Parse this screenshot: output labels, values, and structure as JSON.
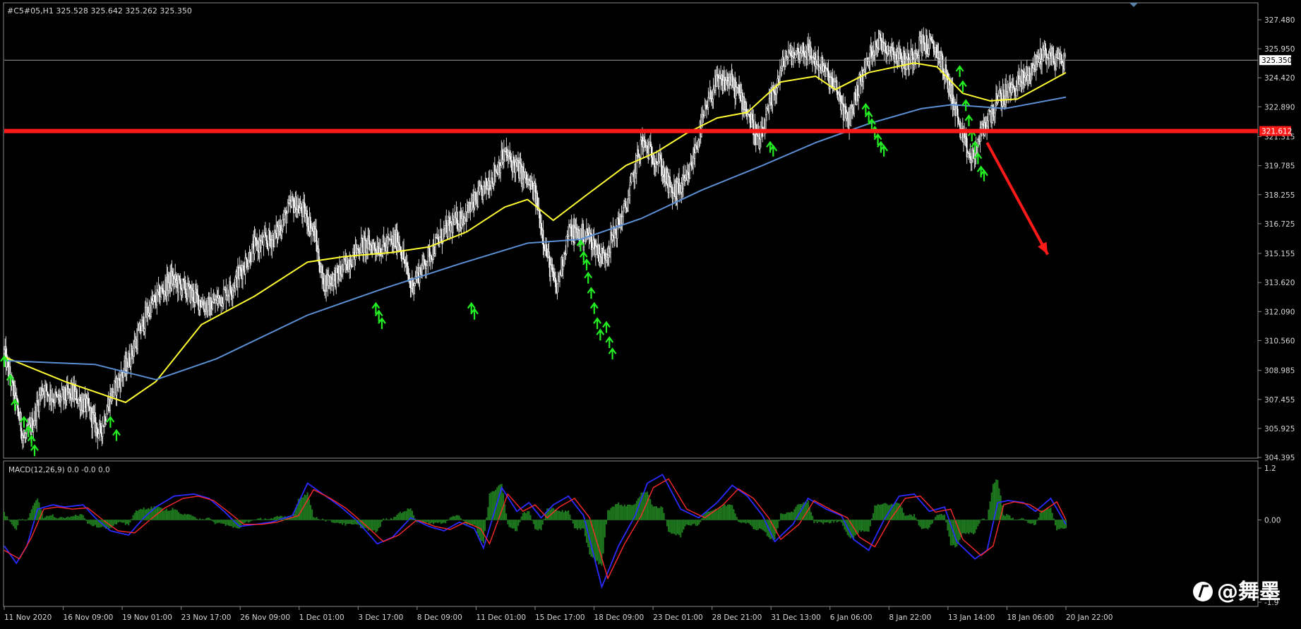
{
  "chart_data": [
    {
      "type": "candlestick",
      "symbol_info": "#C5#05,H1  325.528 325.642 325.262 325.350",
      "ylim": [
        304.395,
        327.48
      ],
      "y_ticks": [
        327.48,
        325.95,
        324.42,
        322.89,
        321.315,
        319.785,
        318.255,
        316.725,
        315.155,
        313.62,
        312.09,
        310.56,
        308.985,
        307.455,
        305.925,
        304.395
      ],
      "y_tick_labels": [
        "327.480",
        "325.950",
        "324.420",
        "322.890",
        "321.315",
        "319.785",
        "318.255",
        "316.725",
        "315.155",
        "313.620",
        "312.090",
        "310.560",
        "308.985",
        "307.455",
        "305.925",
        "304.395"
      ],
      "x_tick_labels": [
        "11 Nov 2020",
        "16 Nov 09:00",
        "19 Nov 01:00",
        "23 Nov 17:00",
        "26 Nov 09:00",
        "1 Dec 01:00",
        "3 Dec 17:00",
        "8 Dec 09:00",
        "11 Dec 01:00",
        "15 Dec 17:00",
        "18 Dec 09:00",
        "23 Dec 01:00",
        "28 Dec 21:00",
        "31 Dec 13:00",
        "6 Jan 06:00",
        "8 Jan 22:00",
        "13 Jan 14:00",
        "18 Jan 06:00",
        "20 Jan 22:00"
      ],
      "current_price": 325.35,
      "current_price_label": "325.350",
      "support_level": 321.612,
      "support_label": "321.612",
      "price_path": [
        [
          0,
          309.9
        ],
        [
          8,
          307.2
        ],
        [
          13,
          305.3
        ],
        [
          18,
          306.0
        ],
        [
          25,
          308.1
        ],
        [
          35,
          307.4
        ],
        [
          45,
          307.8
        ],
        [
          55,
          307.0
        ],
        [
          63,
          305.6
        ],
        [
          70,
          307.6
        ],
        [
          80,
          309.1
        ],
        [
          95,
          312.2
        ],
        [
          110,
          313.8
        ],
        [
          120,
          313.2
        ],
        [
          135,
          312.3
        ],
        [
          150,
          313.4
        ],
        [
          165,
          315.5
        ],
        [
          178,
          316.0
        ],
        [
          190,
          317.8
        ],
        [
          198,
          317.3
        ],
        [
          205,
          316.1
        ],
        [
          210,
          313.6
        ],
        [
          220,
          314.0
        ],
        [
          235,
          315.6
        ],
        [
          250,
          315.5
        ],
        [
          260,
          315.9
        ],
        [
          268,
          313.4
        ],
        [
          278,
          314.8
        ],
        [
          290,
          316.3
        ],
        [
          305,
          317.3
        ],
        [
          318,
          318.7
        ],
        [
          330,
          320.4
        ],
        [
          340,
          319.5
        ],
        [
          350,
          318.3
        ],
        [
          358,
          315.0
        ],
        [
          364,
          313.2
        ],
        [
          372,
          316.3
        ],
        [
          385,
          316.1
        ],
        [
          395,
          314.9
        ],
        [
          410,
          317.6
        ],
        [
          420,
          321.0
        ],
        [
          432,
          320.0
        ],
        [
          440,
          318.3
        ],
        [
          450,
          318.9
        ],
        [
          460,
          322.0
        ],
        [
          468,
          324.0
        ],
        [
          478,
          324.3
        ],
        [
          488,
          323.1
        ],
        [
          498,
          320.9
        ],
        [
          505,
          323.0
        ],
        [
          515,
          325.5
        ],
        [
          528,
          325.9
        ],
        [
          538,
          325.1
        ],
        [
          550,
          323.6
        ],
        [
          556,
          322.0
        ],
        [
          565,
          324.4
        ],
        [
          575,
          326.4
        ],
        [
          585,
          325.9
        ],
        [
          595,
          325.2
        ],
        [
          605,
          326.3
        ],
        [
          615,
          325.9
        ],
        [
          625,
          323.5
        ],
        [
          632,
          321.1
        ],
        [
          638,
          320.0
        ],
        [
          645,
          321.7
        ],
        [
          655,
          323.2
        ],
        [
          665,
          323.9
        ],
        [
          675,
          324.6
        ],
        [
          685,
          325.8
        ],
        [
          692,
          325.4
        ],
        [
          700,
          325.35
        ]
      ],
      "series": [
        {
          "name": "",
          "color": "#ffff33",
          "values": [
            [
              0,
              309.7
            ],
            [
              40,
              308.4
            ],
            [
              80,
              307.3
            ],
            [
              100,
              308.4
            ],
            [
              130,
              311.4
            ],
            [
              165,
              312.9
            ],
            [
              200,
              314.7
            ],
            [
              225,
              315.0
            ],
            [
              255,
              315.2
            ],
            [
              280,
              315.5
            ],
            [
              305,
              316.3
            ],
            [
              330,
              317.6
            ],
            [
              345,
              318.0
            ],
            [
              362,
              316.9
            ],
            [
              385,
              318.3
            ],
            [
              410,
              319.8
            ],
            [
              430,
              320.5
            ],
            [
              450,
              321.5
            ],
            [
              470,
              322.3
            ],
            [
              490,
              322.6
            ],
            [
              512,
              324.2
            ],
            [
              535,
              324.5
            ],
            [
              548,
              323.8
            ],
            [
              570,
              324.7
            ],
            [
              600,
              325.2
            ],
            [
              615,
              325.0
            ],
            [
              632,
              323.6
            ],
            [
              650,
              323.2
            ],
            [
              668,
              323.3
            ],
            [
              700,
              324.7
            ]
          ]
        },
        {
          "name": "",
          "color": "#5b8fd4",
          "values": [
            [
              0,
              309.5
            ],
            [
              60,
              309.3
            ],
            [
              100,
              308.5
            ],
            [
              140,
              309.6
            ],
            [
              200,
              311.9
            ],
            [
              250,
              313.3
            ],
            [
              300,
              314.6
            ],
            [
              345,
              315.7
            ],
            [
              380,
              315.9
            ],
            [
              420,
              317.0
            ],
            [
              460,
              318.5
            ],
            [
              500,
              319.8
            ],
            [
              535,
              321.0
            ],
            [
              570,
              322.0
            ],
            [
              605,
              322.8
            ],
            [
              625,
              323.0
            ],
            [
              660,
              322.8
            ],
            [
              700,
              323.4
            ]
          ]
        }
      ],
      "signals": [
        [
          0,
          309.5
        ],
        [
          4,
          308.5
        ],
        [
          7,
          307.2
        ],
        [
          13,
          306.3
        ],
        [
          16,
          305.8
        ],
        [
          18,
          305.3
        ],
        [
          20,
          304.8
        ],
        [
          70,
          306.3
        ],
        [
          74,
          305.6
        ],
        [
          245,
          312.3
        ],
        [
          247,
          311.9
        ],
        [
          249,
          311.5
        ],
        [
          308,
          312.3
        ],
        [
          310,
          312.0
        ],
        [
          380,
          315.6
        ],
        [
          382,
          315.0
        ],
        [
          384,
          314.6
        ],
        [
          385,
          313.9
        ],
        [
          387,
          313.1
        ],
        [
          389,
          312.3
        ],
        [
          391,
          311.5
        ],
        [
          393,
          310.9
        ],
        [
          397,
          311.3
        ],
        [
          399,
          310.5
        ],
        [
          401,
          309.9
        ],
        [
          505,
          320.8
        ],
        [
          507,
          320.6
        ],
        [
          568,
          322.8
        ],
        [
          570,
          322.4
        ],
        [
          572,
          322.0
        ],
        [
          574,
          321.6
        ],
        [
          576,
          321.2
        ],
        [
          578,
          320.8
        ],
        [
          580,
          320.6
        ],
        [
          630,
          324.8
        ],
        [
          632,
          324.0
        ],
        [
          634,
          323.0
        ],
        [
          636,
          322.2
        ],
        [
          638,
          321.4
        ],
        [
          640,
          320.8
        ],
        [
          642,
          320.2
        ],
        [
          644,
          319.5
        ],
        [
          646,
          319.3
        ]
      ],
      "annotation_arrow": {
        "from": [
          648,
          321.0
        ],
        "to": [
          688,
          315.1
        ]
      }
    },
    {
      "type": "macd",
      "legend": "MACD(12,26,9) 0.0 -0.0 0.0",
      "ylim": [
        -1.9,
        1.2
      ],
      "y_tick_labels": [
        "1.2",
        "0.00",
        "-1.9"
      ],
      "macd_series": [
        [
          0,
          -0.6
        ],
        [
          8,
          -1.0
        ],
        [
          15,
          -0.6
        ],
        [
          22,
          0.25
        ],
        [
          32,
          0.35
        ],
        [
          40,
          0.3
        ],
        [
          52,
          0.35
        ],
        [
          60,
          0.05
        ],
        [
          70,
          -0.25
        ],
        [
          82,
          -0.35
        ],
        [
          92,
          0.05
        ],
        [
          100,
          0.3
        ],
        [
          112,
          0.55
        ],
        [
          125,
          0.6
        ],
        [
          135,
          0.5
        ],
        [
          145,
          0.2
        ],
        [
          155,
          -0.15
        ],
        [
          166,
          -0.1
        ],
        [
          176,
          -0.05
        ],
        [
          190,
          0.1
        ],
        [
          200,
          0.85
        ],
        [
          212,
          0.55
        ],
        [
          222,
          0.3
        ],
        [
          232,
          0.0
        ],
        [
          246,
          -0.55
        ],
        [
          256,
          -0.4
        ],
        [
          268,
          0.05
        ],
        [
          280,
          -0.15
        ],
        [
          290,
          -0.25
        ],
        [
          300,
          -0.05
        ],
        [
          310,
          -0.2
        ],
        [
          316,
          -0.65
        ],
        [
          328,
          0.75
        ],
        [
          338,
          0.2
        ],
        [
          346,
          0.4
        ],
        [
          354,
          0.05
        ],
        [
          362,
          0.35
        ],
        [
          372,
          0.55
        ],
        [
          382,
          0.1
        ],
        [
          394,
          -1.55
        ],
        [
          405,
          -0.6
        ],
        [
          416,
          0.1
        ],
        [
          424,
          0.85
        ],
        [
          434,
          1.05
        ],
        [
          446,
          0.25
        ],
        [
          458,
          0.05
        ],
        [
          470,
          0.4
        ],
        [
          480,
          0.8
        ],
        [
          490,
          0.55
        ],
        [
          500,
          0.1
        ],
        [
          508,
          -0.5
        ],
        [
          520,
          -0.1
        ],
        [
          530,
          0.5
        ],
        [
          542,
          0.25
        ],
        [
          552,
          0.1
        ],
        [
          560,
          -0.45
        ],
        [
          570,
          -0.7
        ],
        [
          580,
          0.0
        ],
        [
          590,
          0.55
        ],
        [
          600,
          0.6
        ],
        [
          610,
          0.2
        ],
        [
          620,
          0.3
        ],
        [
          628,
          -0.5
        ],
        [
          640,
          -0.9
        ],
        [
          648,
          -0.7
        ],
        [
          655,
          0.4
        ],
        [
          662,
          0.45
        ],
        [
          672,
          0.4
        ],
        [
          680,
          0.2
        ],
        [
          690,
          0.5
        ],
        [
          700,
          -0.1
        ]
      ],
      "signal_series": [
        [
          0,
          -0.7
        ],
        [
          10,
          -0.9
        ],
        [
          18,
          -0.4
        ],
        [
          26,
          0.25
        ],
        [
          35,
          0.3
        ],
        [
          45,
          0.25
        ],
        [
          55,
          0.28
        ],
        [
          65,
          0.0
        ],
        [
          75,
          -0.25
        ],
        [
          86,
          -0.3
        ],
        [
          96,
          0.0
        ],
        [
          106,
          0.28
        ],
        [
          118,
          0.5
        ],
        [
          128,
          0.55
        ],
        [
          138,
          0.45
        ],
        [
          148,
          0.18
        ],
        [
          158,
          -0.1
        ],
        [
          170,
          -0.1
        ],
        [
          180,
          -0.05
        ],
        [
          194,
          0.1
        ],
        [
          204,
          0.7
        ],
        [
          215,
          0.5
        ],
        [
          225,
          0.28
        ],
        [
          236,
          -0.05
        ],
        [
          250,
          -0.5
        ],
        [
          260,
          -0.35
        ],
        [
          272,
          0.0
        ],
        [
          284,
          -0.15
        ],
        [
          294,
          -0.22
        ],
        [
          304,
          -0.05
        ],
        [
          314,
          -0.2
        ],
        [
          320,
          -0.55
        ],
        [
          332,
          0.6
        ],
        [
          342,
          0.2
        ],
        [
          350,
          0.35
        ],
        [
          358,
          0.05
        ],
        [
          366,
          0.3
        ],
        [
          376,
          0.5
        ],
        [
          386,
          0.05
        ],
        [
          398,
          -1.35
        ],
        [
          409,
          -0.55
        ],
        [
          420,
          0.1
        ],
        [
          428,
          0.75
        ],
        [
          438,
          0.95
        ],
        [
          450,
          0.25
        ],
        [
          462,
          0.05
        ],
        [
          474,
          0.35
        ],
        [
          484,
          0.72
        ],
        [
          494,
          0.5
        ],
        [
          504,
          0.05
        ],
        [
          512,
          -0.45
        ],
        [
          524,
          -0.1
        ],
        [
          534,
          0.45
        ],
        [
          546,
          0.22
        ],
        [
          556,
          0.05
        ],
        [
          564,
          -0.4
        ],
        [
          574,
          -0.62
        ],
        [
          584,
          0.0
        ],
        [
          594,
          0.5
        ],
        [
          604,
          0.55
        ],
        [
          614,
          0.18
        ],
        [
          624,
          0.25
        ],
        [
          632,
          -0.45
        ],
        [
          644,
          -0.82
        ],
        [
          652,
          -0.6
        ],
        [
          659,
          0.35
        ],
        [
          666,
          0.42
        ],
        [
          676,
          0.36
        ],
        [
          684,
          0.18
        ],
        [
          694,
          0.42
        ],
        [
          700,
          0.0
        ]
      ]
    }
  ],
  "watermark": {
    "text": "@舞墨"
  }
}
